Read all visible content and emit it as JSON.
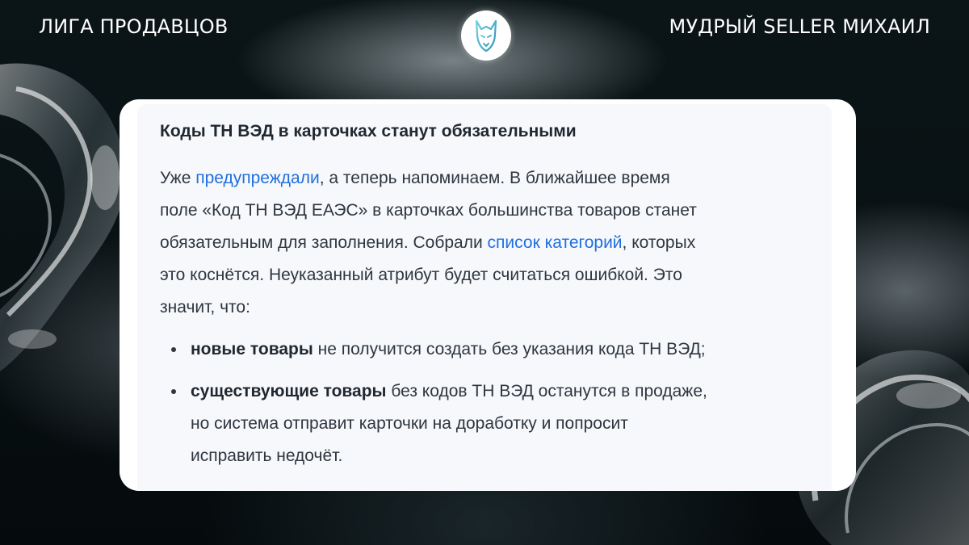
{
  "header": {
    "left": "ЛИГА ПРОДАВЦОВ",
    "right": "МУДРЫЙ SELLER МИХАИЛ"
  },
  "logo": {
    "icon": "wolf-head-icon"
  },
  "article": {
    "title": "Коды ТН ВЭД в карточках станут обязательными",
    "para": {
      "l1_a": "Уже ",
      "l1_link": "предупреждали",
      "l1_b": ", а теперь напоминаем. В ближайшее время",
      "l2": "поле «Код ТН ВЭД ЕАЭС» в карточках большинства товаров станет",
      "l3_a": "обязательным для заполнения. Собрали ",
      "l3_link": "список категорий",
      "l3_b": ", которых",
      "l4": "это коснётся. Неуказанный атрибут будет считаться ошибкой. Это",
      "l5": "значит, что:"
    },
    "bullets": [
      {
        "bold": "новые товары",
        "l1": " не получится создать без указания кода ТН ВЭД;"
      },
      {
        "bold": "существующие товары",
        "l1": " без кодов ТН ВЭД останутся в продаже,",
        "l2": "но система отправит карточки на доработку и попросит",
        "l3": "исправить недочёт."
      }
    ]
  },
  "colors": {
    "link": "#1f6fe0",
    "text": "#2e3640",
    "card": "#ffffff",
    "background": "#050c0e"
  }
}
